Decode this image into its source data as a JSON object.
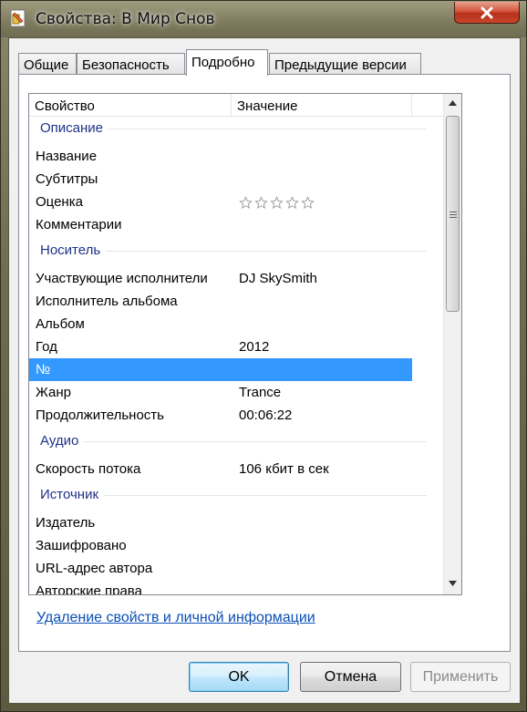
{
  "window": {
    "title": "Свойства: В Мир Снов",
    "accent_close": "#c7452b"
  },
  "tabs": [
    {
      "label": "Общие",
      "active": false
    },
    {
      "label": "Безопасность",
      "active": false
    },
    {
      "label": "Подробно",
      "active": true
    },
    {
      "label": "Предыдущие версии",
      "active": false
    }
  ],
  "list": {
    "columns": {
      "property": "Свойство",
      "value": "Значение"
    },
    "groups": {
      "description": {
        "label": "Описание",
        "rows": [
          {
            "property": "Название",
            "value": ""
          },
          {
            "property": "Субтитры",
            "value": ""
          },
          {
            "property": "Оценка",
            "value": "",
            "rating_stars": 0,
            "rating_max": 5
          },
          {
            "property": "Комментарии",
            "value": ""
          }
        ]
      },
      "media": {
        "label": "Носитель",
        "rows": [
          {
            "property": "Участвующие исполнители",
            "value": "DJ SkySmith"
          },
          {
            "property": "Исполнитель альбома",
            "value": ""
          },
          {
            "property": "Альбом",
            "value": ""
          },
          {
            "property": "Год",
            "value": "2012"
          },
          {
            "property": "№",
            "value": "",
            "selected": true
          },
          {
            "property": "Жанр",
            "value": "Trance"
          },
          {
            "property": "Продолжительность",
            "value": "00:06:22"
          }
        ]
      },
      "audio": {
        "label": "Аудио",
        "rows": [
          {
            "property": "Скорость потока",
            "value": "106 кбит в сек"
          }
        ]
      },
      "source": {
        "label": "Источник",
        "rows": [
          {
            "property": "Издатель",
            "value": ""
          },
          {
            "property": "Зашифровано",
            "value": ""
          },
          {
            "property": "URL-адрес автора",
            "value": ""
          },
          {
            "property": "Авторские права",
            "value": ""
          }
        ]
      }
    },
    "selection_color": "#3399ff"
  },
  "remove_link": "Удаление свойств и личной информации",
  "buttons": {
    "ok": "OK",
    "cancel": "Отмена",
    "apply": "Применить"
  }
}
